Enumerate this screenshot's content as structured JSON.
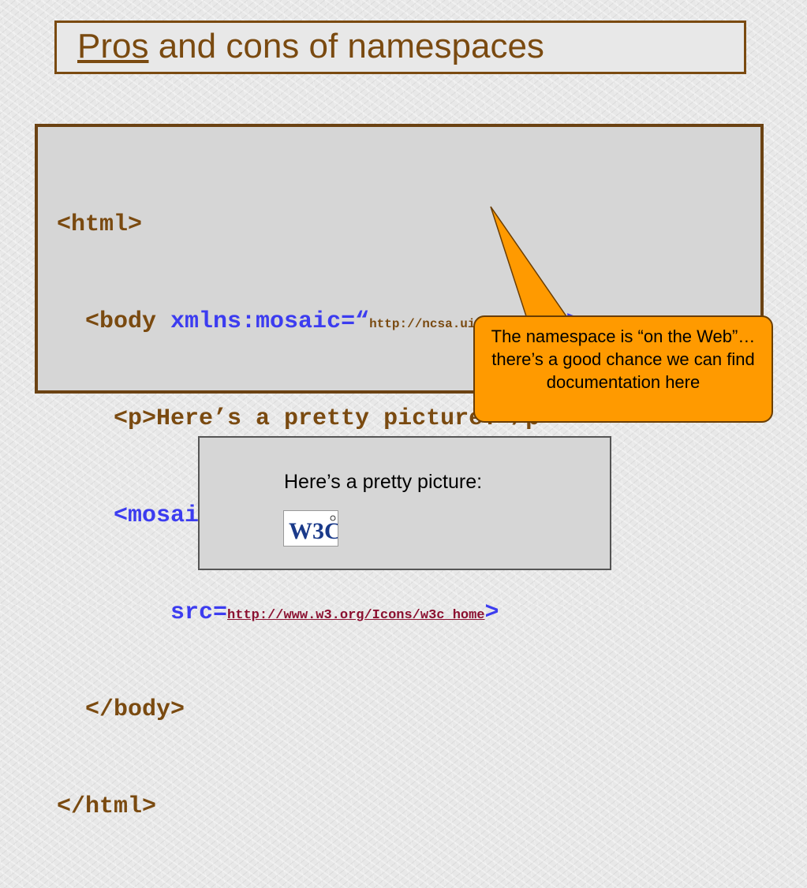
{
  "title": {
    "link_text": "Pros",
    "rest_text": " and cons of namespaces"
  },
  "code": {
    "line1": "<html>",
    "line2_prefix": "  <body ",
    "line2_attr": "xmlns:mosaic=“",
    "line2_url": "http://ncsa.uiuc.edu/tags”",
    "line2_close": ">",
    "line3": "    <p>Here’s a pretty picture:</p>",
    "line4": "    <mosaic:img",
    "line5_prefix": "        src=",
    "line5_url": "http://www.w3.org/Icons/w3c_home",
    "line5_close": ">",
    "line6": "  </body>",
    "line7": "</html>"
  },
  "callout": {
    "text": "The namespace is “on the Web”…there’s a good chance we can find documentation here"
  },
  "preview": {
    "text": "Here’s a pretty picture:",
    "logo_text": "W3C"
  },
  "colors": {
    "title_brown": "#7a4a10",
    "code_blue": "#3c3cf0",
    "callout_orange": "#ff9a00"
  }
}
